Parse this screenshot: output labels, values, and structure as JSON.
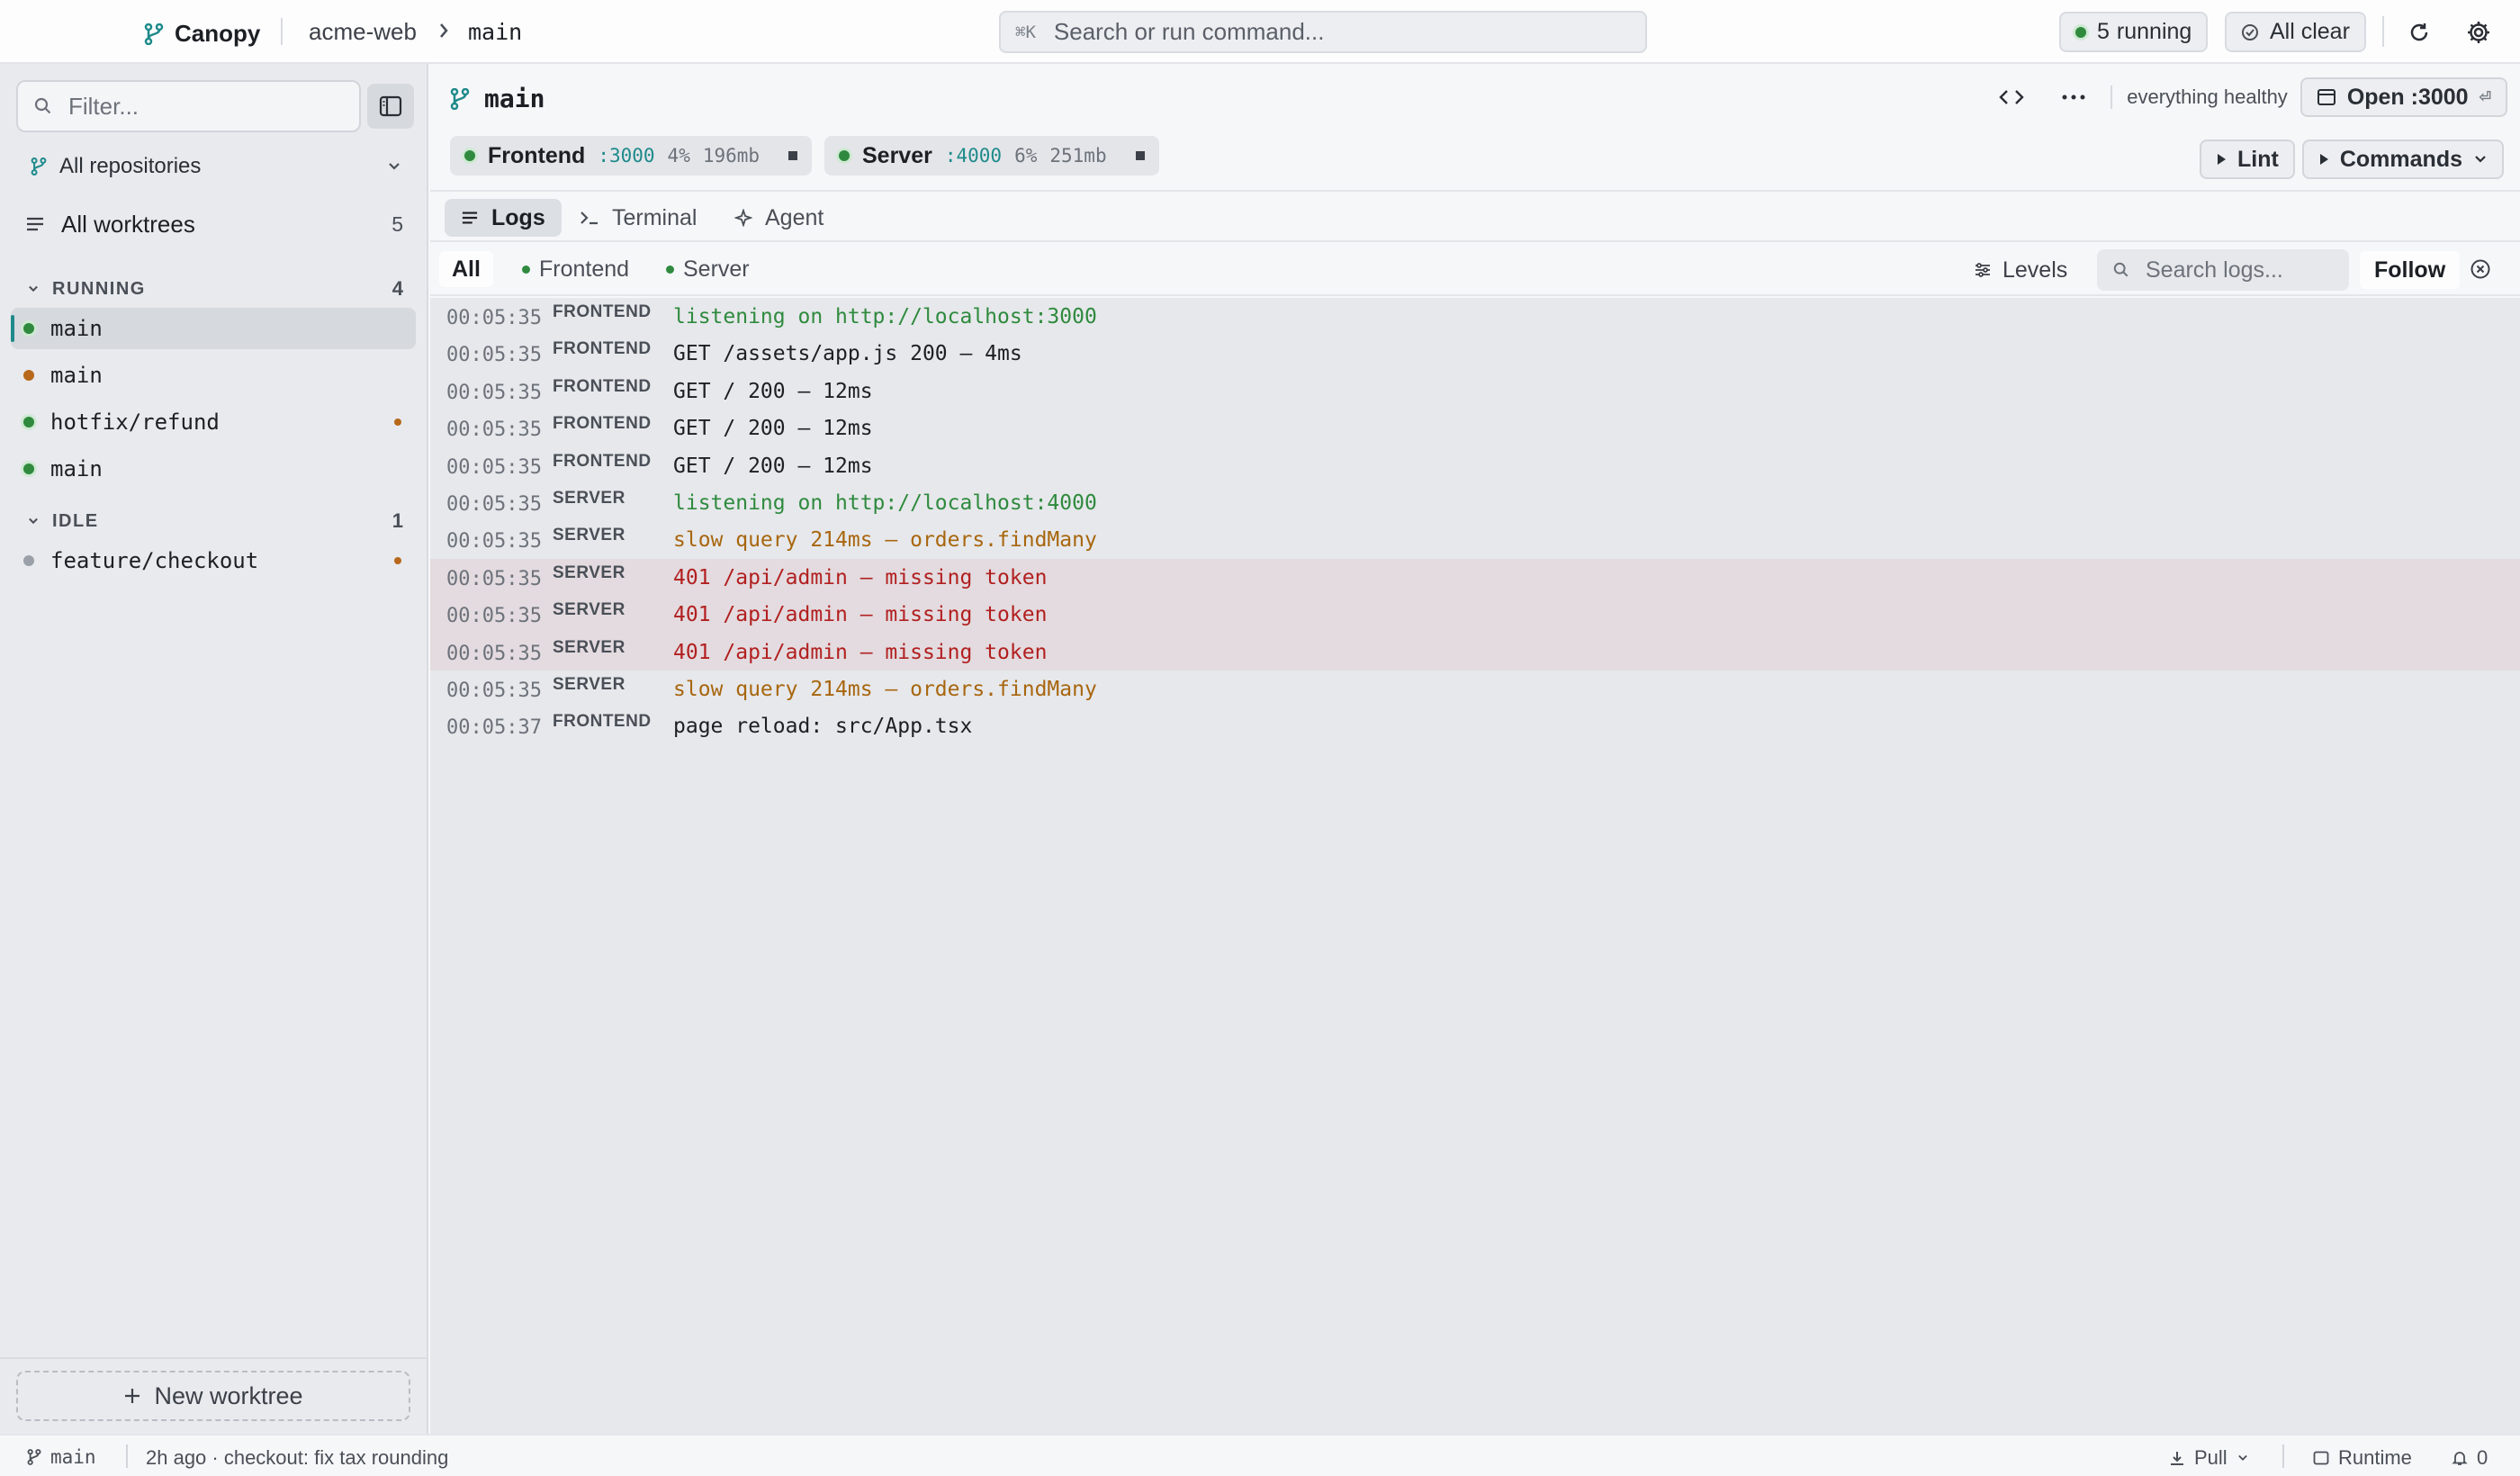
{
  "app": {
    "name": "Canopy"
  },
  "breadcrumb": {
    "repo": "acme-web",
    "branch": "main"
  },
  "command_bar": {
    "shortcut": "⌘K",
    "placeholder": "Search or run command..."
  },
  "top_status": {
    "running_count": "5",
    "running_label": "running",
    "all_clear": "All clear"
  },
  "sidebar": {
    "filter_placeholder": "Filter...",
    "repo_select": "All repositories",
    "all_worktrees": {
      "label": "All worktrees",
      "count": "5"
    },
    "sections": [
      {
        "title": "RUNNING",
        "count": "4",
        "items": [
          {
            "name": "main",
            "status": "running",
            "badge": false,
            "active": true
          },
          {
            "name": "main",
            "status": "warning",
            "badge": false,
            "active": false
          },
          {
            "name": "hotfix/refund",
            "status": "running",
            "badge": true,
            "active": false
          },
          {
            "name": "main",
            "status": "running",
            "badge": false,
            "active": false
          }
        ]
      },
      {
        "title": "IDLE",
        "count": "1",
        "items": [
          {
            "name": "feature/checkout",
            "status": "idle",
            "badge": true,
            "active": false
          }
        ]
      }
    ],
    "new_worktree": "New worktree"
  },
  "main": {
    "title": "main",
    "health": "everything healthy",
    "open_button": "Open :3000",
    "services": [
      {
        "name": "Frontend",
        "port": ":3000",
        "cpu": "4%",
        "mem": "196mb"
      },
      {
        "name": "Server",
        "port": ":4000",
        "cpu": "6%",
        "mem": "251mb"
      }
    ],
    "lint_button": "Lint",
    "commands_button": "Commands",
    "tabs": [
      "Logs",
      "Terminal",
      "Agent"
    ],
    "active_tab": "Logs",
    "sources": [
      "All",
      "Frontend",
      "Server"
    ],
    "levels_label": "Levels",
    "log_search_placeholder": "Search logs...",
    "follow_label": "Follow"
  },
  "logs": [
    {
      "time": "00:05:35",
      "source": "FRONTEND",
      "message": "listening on http://localhost:3000",
      "level": "info"
    },
    {
      "time": "00:05:35",
      "source": "FRONTEND",
      "message": "GET /assets/app.js 200 — 4ms",
      "level": "plain"
    },
    {
      "time": "00:05:35",
      "source": "FRONTEND",
      "message": "GET / 200 — 12ms",
      "level": "plain"
    },
    {
      "time": "00:05:35",
      "source": "FRONTEND",
      "message": "GET / 200 — 12ms",
      "level": "plain"
    },
    {
      "time": "00:05:35",
      "source": "FRONTEND",
      "message": "GET / 200 — 12ms",
      "level": "plain"
    },
    {
      "time": "00:05:35",
      "source": "SERVER",
      "message": "listening on http://localhost:4000",
      "level": "info"
    },
    {
      "time": "00:05:35",
      "source": "SERVER",
      "message": "slow query 214ms — orders.findMany",
      "level": "warn"
    },
    {
      "time": "00:05:35",
      "source": "SERVER",
      "message": "401 /api/admin — missing token",
      "level": "error"
    },
    {
      "time": "00:05:35",
      "source": "SERVER",
      "message": "401 /api/admin — missing token",
      "level": "error"
    },
    {
      "time": "00:05:35",
      "source": "SERVER",
      "message": "401 /api/admin — missing token",
      "level": "error"
    },
    {
      "time": "00:05:35",
      "source": "SERVER",
      "message": "slow query 214ms — orders.findMany",
      "level": "warn"
    },
    {
      "time": "00:05:37",
      "source": "FRONTEND",
      "message": "page reload: src/App.tsx",
      "level": "plain"
    }
  ],
  "statusbar": {
    "branch": "main",
    "last_commit": "2h ago · checkout: fix tax rounding",
    "pull": "Pull",
    "runtime": "Runtime",
    "notifications": "0"
  },
  "colors": {
    "accent": "#1e8a8a",
    "running": "#2f8a3e",
    "warning": "#b7681a",
    "error": "#b21f1f"
  },
  "icons": [
    "branch-icon",
    "search-icon",
    "refresh-icon",
    "gear-icon",
    "panel-icon",
    "list-icon",
    "chevron-down-icon",
    "code-icon",
    "more-icon",
    "window-icon",
    "play-icon",
    "terminal-icon",
    "sparkle-icon",
    "levels-icon",
    "close-circle-icon",
    "plus-icon",
    "download-icon",
    "bell-icon",
    "check-circle-icon"
  ]
}
